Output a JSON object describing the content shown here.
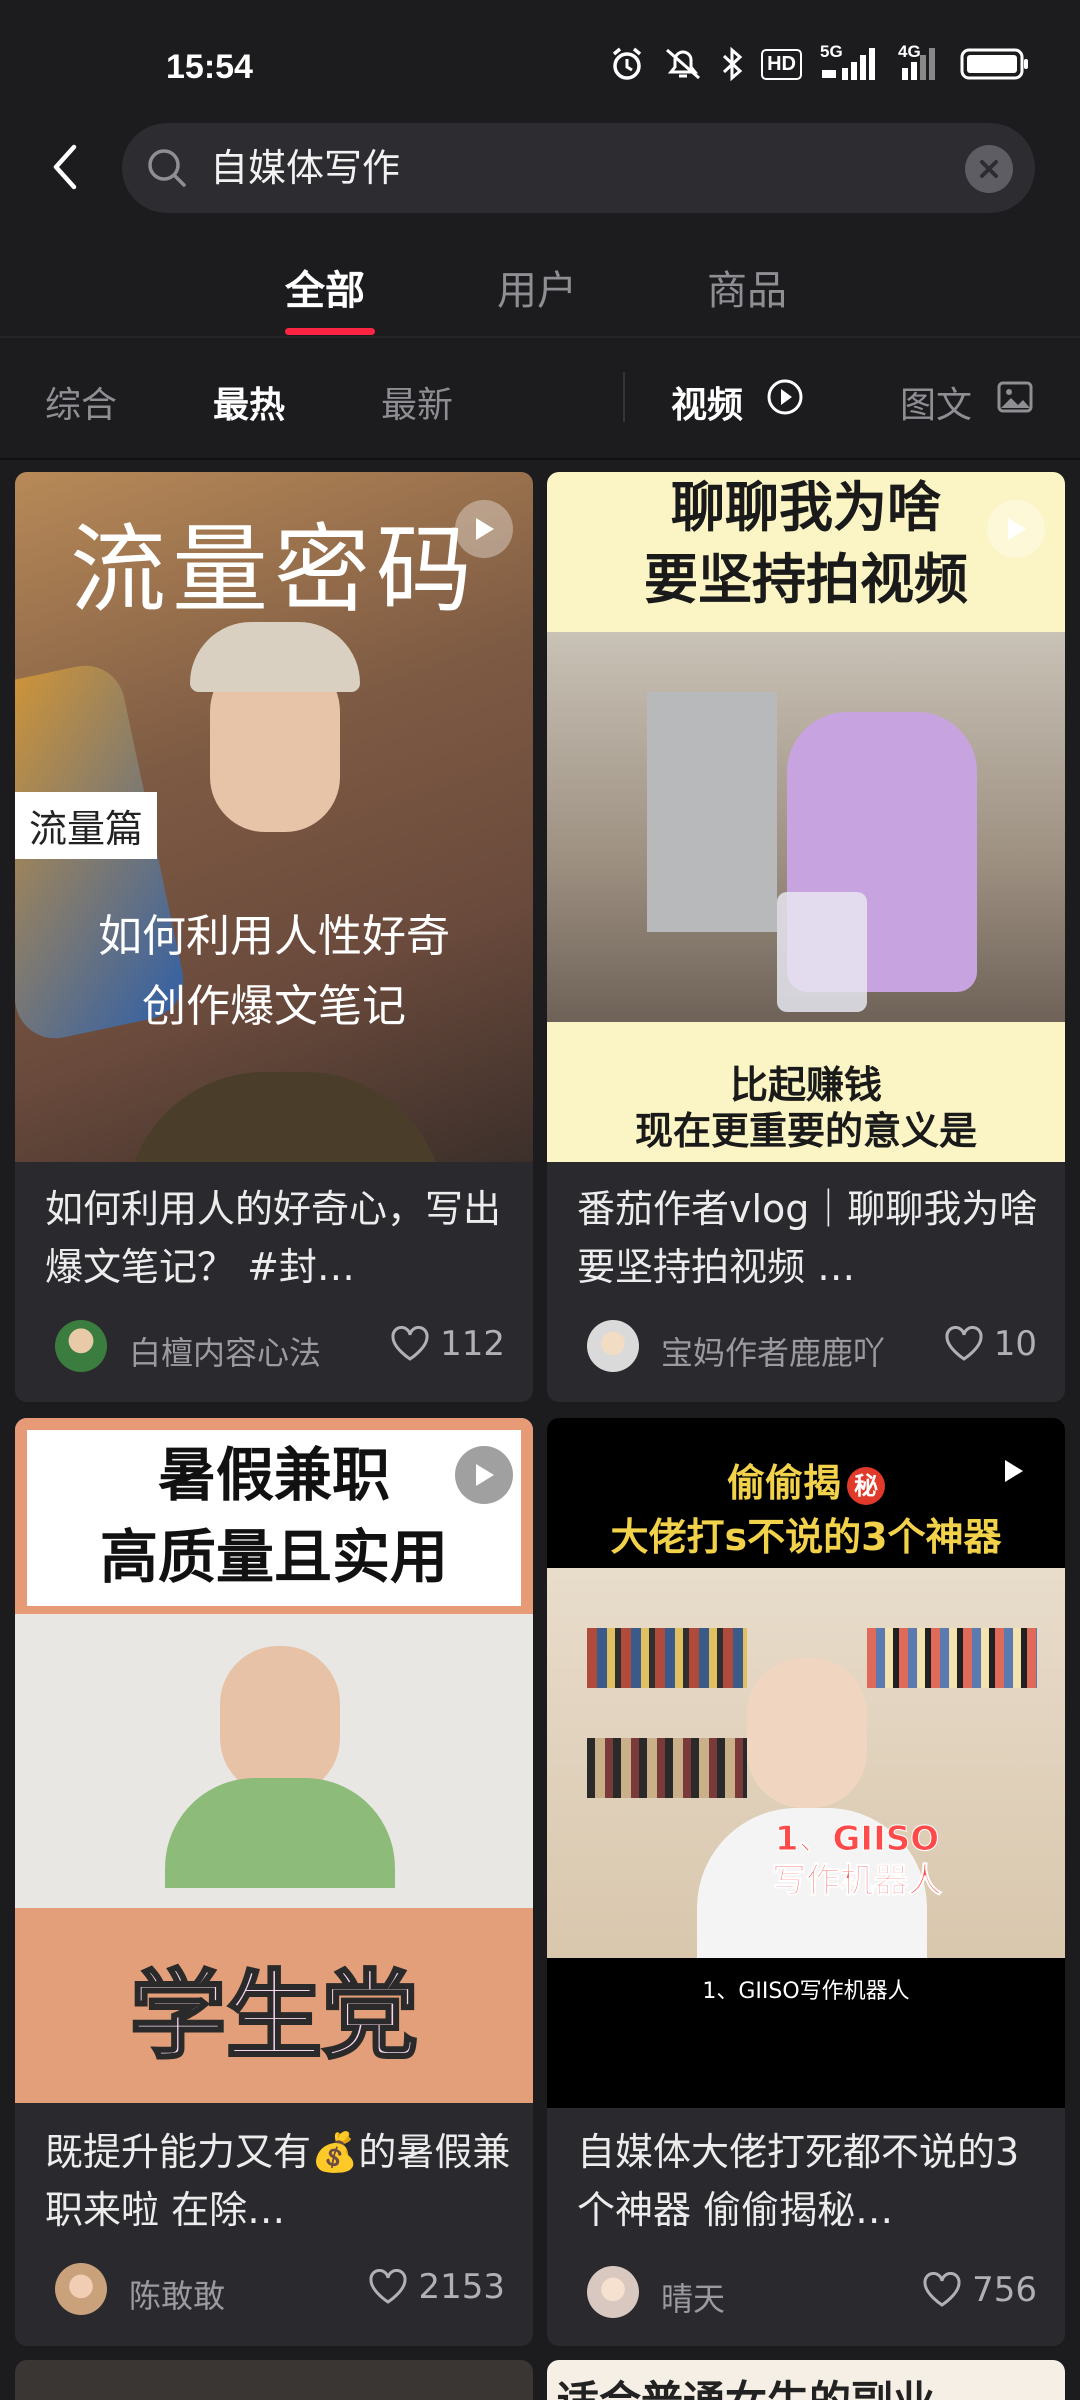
{
  "status_bar": {
    "time": "15:54",
    "icons": [
      "alarm-icon",
      "mute-icon",
      "bluetooth-icon",
      "hd-icon",
      "signal-5g-icon",
      "signal-4g-icon",
      "battery-icon"
    ],
    "hd_label": "HD",
    "net1": "5G",
    "net2": "4G"
  },
  "header": {
    "back_icon": "chevron-left-icon",
    "search_query": "自媒体写作",
    "clear_icon": "clear-icon"
  },
  "top_tabs": [
    {
      "label": "全部",
      "active": true
    },
    {
      "label": "用户",
      "active": false
    },
    {
      "label": "商品",
      "active": false
    }
  ],
  "filters": {
    "sort": [
      {
        "label": "综合",
        "active": false
      },
      {
        "label": "最热",
        "active": true
      },
      {
        "label": "最新",
        "active": false
      }
    ],
    "video_label": "视频",
    "image_text_label": "图文"
  },
  "colors": {
    "accent": "#ff2442",
    "background": "#1c1c1f",
    "card": "#2a2a2e"
  },
  "cards": [
    {
      "cover": {
        "headline": "流量密码",
        "tag": "流量篇",
        "caption_line1": "如何利用人性好奇",
        "caption_line2": "创作爆文笔记"
      },
      "title": "如何利用人的好奇心，写出爆文笔记？ #封…",
      "author": "白檀内容心法",
      "likes": "112"
    },
    {
      "cover": {
        "headline_line1": "聊聊我为啥",
        "headline_line2": "要坚持拍视频",
        "caption_line1": "比起赚钱",
        "caption_line2": "现在更重要的意义是"
      },
      "title": "番茄作者vlog｜聊聊我为啥要坚持拍视频 …",
      "author": "宝妈作者鹿鹿吖",
      "likes": "10"
    },
    {
      "cover": {
        "headline_line1": "暑假兼职",
        "headline_line2": "高质量且实用",
        "bottom_text": "学生党"
      },
      "title": "既提升能力又有💰的暑假兼职来啦 在除…",
      "author": "陈敢敢",
      "likes": "2153"
    },
    {
      "cover": {
        "headline_line1": "偷偷揭",
        "secret_badge": "秘",
        "headline_line2": "大佬打s不说的3个神器",
        "overlay_line1": "1、GIISO",
        "overlay_line2": "写作机器人",
        "subtitle": "1、GIISO写作机器人"
      },
      "title": "自媒体大佬打死都不说的3个神器 偷偷揭秘…",
      "author": "晴天",
      "likes": "756"
    }
  ],
  "peek_cards": [
    {
      "cover_text": ""
    },
    {
      "cover_text": "适合普通女生的副业"
    }
  ]
}
